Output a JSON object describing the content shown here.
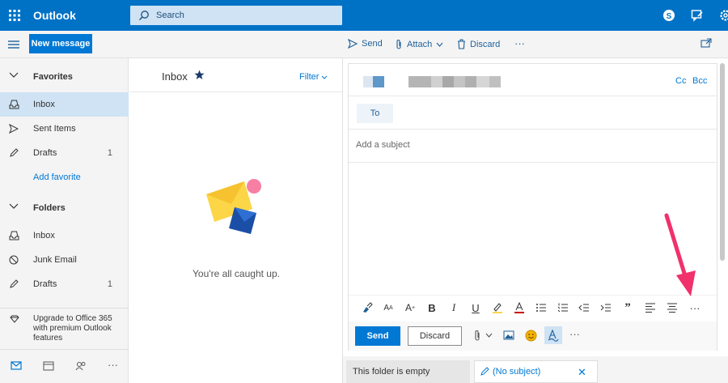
{
  "topbar": {
    "brand": "Outlook",
    "search_placeholder": "Search",
    "icons": [
      "waffle-icon",
      "skype-icon",
      "feedback-icon",
      "settings-icon"
    ]
  },
  "toolbar": {
    "new_message": "New message",
    "send": "Send",
    "attach": "Attach",
    "discard": "Discard",
    "more": "···"
  },
  "nav": {
    "favorites": "Favorites",
    "fav_items": [
      {
        "label": "Inbox",
        "count": ""
      },
      {
        "label": "Sent Items",
        "count": ""
      },
      {
        "label": "Drafts",
        "count": "1"
      }
    ],
    "add_favorite": "Add favorite",
    "folders": "Folders",
    "folder_items": [
      {
        "label": "Inbox",
        "count": ""
      },
      {
        "label": "Junk Email",
        "count": ""
      },
      {
        "label": "Drafts",
        "count": "1"
      }
    ],
    "upgrade": "Upgrade to Office 365 with premium Outlook features",
    "bottom_more": "···"
  },
  "list": {
    "title": "Inbox",
    "filter": "Filter",
    "empty_message": "You're all caught up."
  },
  "compose": {
    "cc": "Cc",
    "bcc": "Bcc",
    "to": "To",
    "subject_placeholder": "Add a subject",
    "send": "Send",
    "discard": "Discard",
    "more": "···",
    "format_more": "···",
    "quote": "”"
  },
  "tabs": {
    "empty": "This folder is empty",
    "draft": "(No subject)",
    "close": "✕"
  },
  "colors": {
    "brand_blue": "#0072c6",
    "accent": "#0078d4",
    "arrow": "#f0316c"
  }
}
